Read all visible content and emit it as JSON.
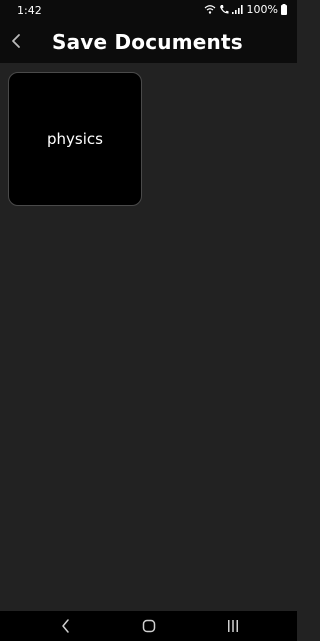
{
  "status_bar": {
    "time": "1:42",
    "battery": "100%",
    "icons": [
      "wifi-icon",
      "call-icon",
      "signal-icon",
      "battery-icon"
    ]
  },
  "app_bar": {
    "title": "Save Documents",
    "back_icon": "chevron-left-icon"
  },
  "folders": [
    {
      "label": "physics"
    }
  ],
  "nav_bar": {
    "buttons": [
      "back-nav-icon",
      "home-nav-icon",
      "recents-nav-icon"
    ]
  },
  "colors": {
    "background": "#222222",
    "app_bar": "#0c0c0c",
    "card": "#000000",
    "text": "#ffffff"
  }
}
